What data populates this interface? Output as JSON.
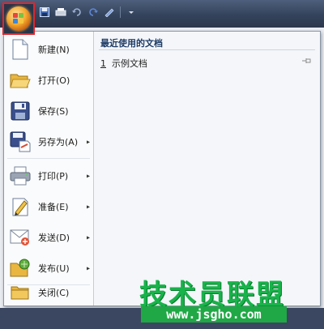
{
  "menu": {
    "items": [
      {
        "label": "新建(N)",
        "icon": "new-document-icon",
        "has_submenu": false
      },
      {
        "label": "打开(O)",
        "icon": "open-folder-icon",
        "has_submenu": false
      },
      {
        "label": "保存(S)",
        "icon": "save-disk-icon",
        "has_submenu": false
      },
      {
        "label": "另存为(A)",
        "icon": "save-as-icon",
        "has_submenu": true
      },
      {
        "label": "打印(P)",
        "icon": "printer-icon",
        "has_submenu": true
      },
      {
        "label": "准备(E)",
        "icon": "prepare-icon",
        "has_submenu": true
      },
      {
        "label": "发送(D)",
        "icon": "send-icon",
        "has_submenu": true
      },
      {
        "label": "发布(U)",
        "icon": "publish-icon",
        "has_submenu": true
      },
      {
        "label": "关闭(C)",
        "icon": "close-folder-icon",
        "has_submenu": false
      }
    ],
    "submenu_arrow": "▸"
  },
  "recent": {
    "title": "最近使用的文档",
    "documents": [
      {
        "number": "1",
        "name": "示例文档"
      }
    ]
  },
  "watermark": {
    "brand": "技术员联盟",
    "url": "www.jsgho.com"
  },
  "colors": {
    "highlight_border": "#e3242b",
    "watermark_green": "#18b34a"
  }
}
